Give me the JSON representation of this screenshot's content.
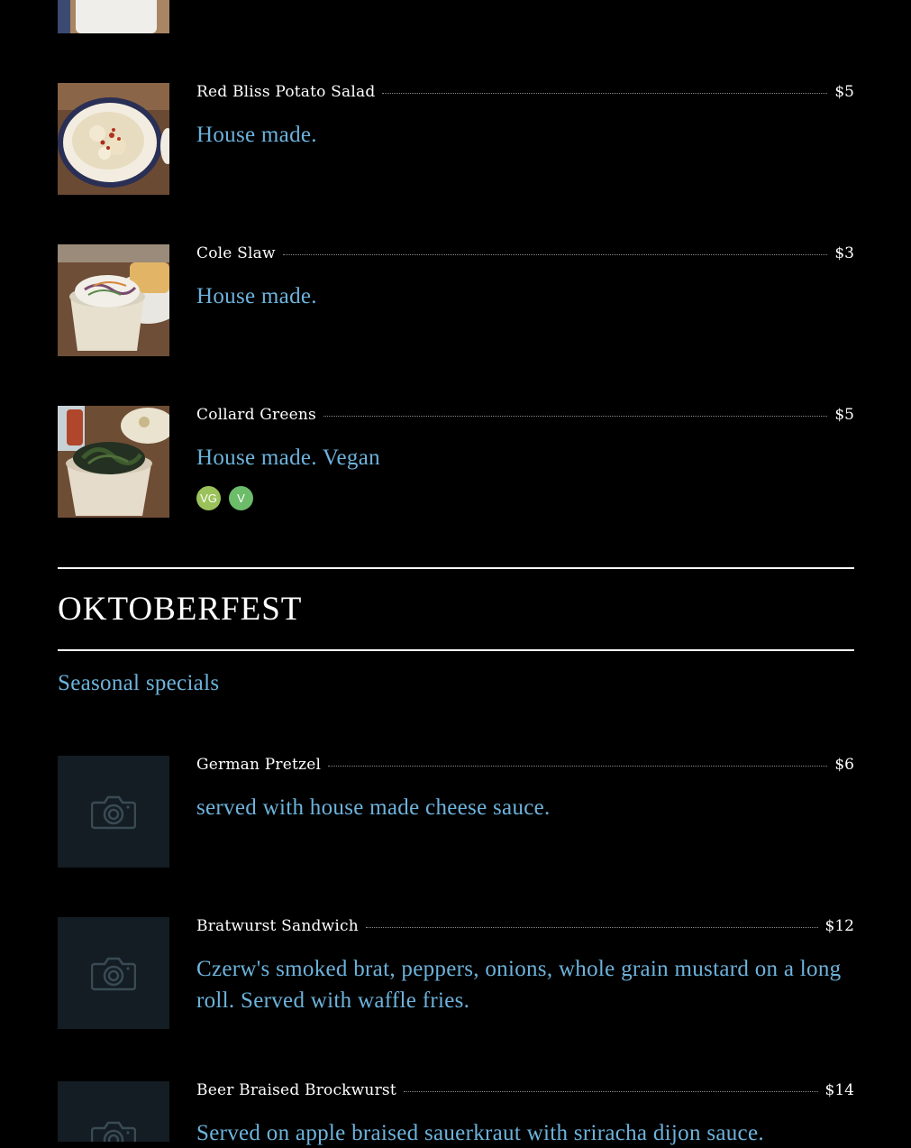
{
  "sides": [
    {
      "name": "Red Bliss Potato Salad",
      "price": "$5",
      "description": "House made.",
      "photo_icon": "potato-salad-photo"
    },
    {
      "name": "Cole Slaw",
      "price": "$3",
      "description": "House made.",
      "photo_icon": "cole-slaw-photo"
    },
    {
      "name": "Collard Greens",
      "price": "$5",
      "description": "House made. Vegan",
      "photo_icon": "collard-greens-photo",
      "badges": [
        "VG",
        "V"
      ]
    }
  ],
  "section": {
    "title": "OKTOBERFEST",
    "subtitle": "Seasonal specials"
  },
  "oktoberfest": [
    {
      "name": "German Pretzel",
      "price": "$6",
      "description": "served with house made cheese sauce.",
      "photo_icon": "camera-icon"
    },
    {
      "name": "Bratwurst Sandwich",
      "price": "$12",
      "description": "Czerw's smoked brat, peppers, onions, whole grain mustard on a long roll. Served with waffle fries.",
      "photo_icon": "camera-icon"
    },
    {
      "name": "Beer Braised Brockwurst",
      "price": "$14",
      "description": "Served on apple braised sauerkraut with sriracha dijon sauce.",
      "photo_icon": "camera-icon"
    }
  ],
  "colors": {
    "background": "#000000",
    "description": "#6db3dc",
    "placeholder": "#131d23",
    "badge_vegan": "#9bc25a",
    "badge_vegetarian": "#6cbc6a"
  }
}
